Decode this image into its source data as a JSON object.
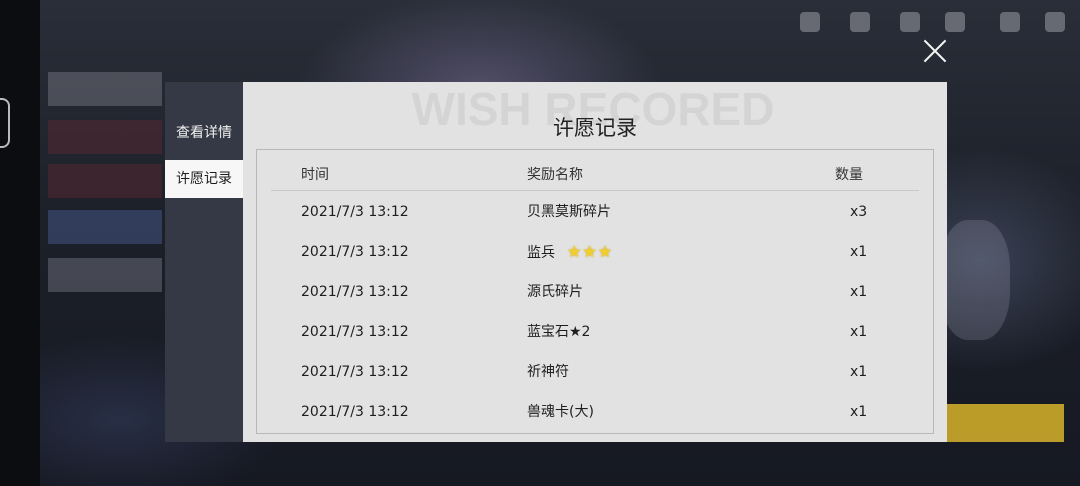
{
  "sidebar": {
    "tabs": [
      {
        "label": "查看详情",
        "active": false
      },
      {
        "label": "许愿记录",
        "active": true
      }
    ]
  },
  "panel": {
    "watermark": "WISH RECORED",
    "title": "许愿记录"
  },
  "table": {
    "headers": {
      "time": "时间",
      "name": "奖励名称",
      "qty": "数量"
    },
    "rows": [
      {
        "time": "2021/7/3 13:12",
        "name": "贝黑莫斯碎片",
        "qty": "x3",
        "stars": ""
      },
      {
        "time": "2021/7/3 13:12",
        "name": "监兵",
        "qty": "x1",
        "stars": "★★★"
      },
      {
        "time": "2021/7/3 13:12",
        "name": "源氏碎片",
        "qty": "x1",
        "stars": ""
      },
      {
        "time": "2021/7/3 13:12",
        "name": "蓝宝石★2",
        "qty": "x1",
        "stars": ""
      },
      {
        "time": "2021/7/3 13:12",
        "name": "祈神符",
        "qty": "x1",
        "stars": ""
      },
      {
        "time": "2021/7/3 13:12",
        "name": "兽魂卡(大)",
        "qty": "x1",
        "stars": ""
      }
    ]
  },
  "icons": {
    "close": "close-icon"
  },
  "colors": {
    "sidebar_bg": "#353845",
    "panel_bg": "#e2e2e2",
    "star": "#f2cf2a"
  }
}
